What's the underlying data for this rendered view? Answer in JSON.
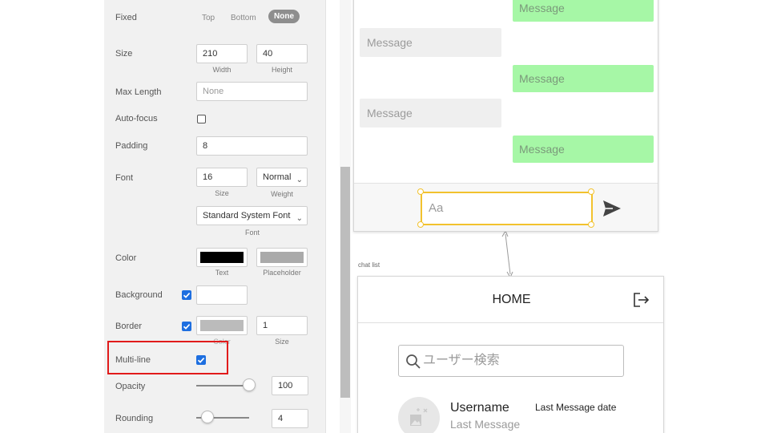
{
  "panel": {
    "fixed": {
      "label": "Fixed",
      "options": [
        "Top",
        "Bottom"
      ],
      "selected": "None"
    },
    "size": {
      "label": "Size",
      "width": "210",
      "height": "40",
      "width_caption": "Width",
      "height_caption": "Height"
    },
    "max_length": {
      "label": "Max Length",
      "placeholder": "None"
    },
    "auto_focus": {
      "label": "Auto-focus",
      "checked": false
    },
    "padding": {
      "label": "Padding",
      "value": "8"
    },
    "font": {
      "label": "Font",
      "size": "16",
      "size_caption": "Size",
      "weight": "Normal",
      "weight_caption": "Weight",
      "family": "Standard System Font",
      "family_caption": "Font"
    },
    "color": {
      "label": "Color",
      "text_caption": "Text",
      "placeholder_caption": "Placeholder",
      "text_color": "#000000",
      "placeholder_color": "#aaaaaa"
    },
    "background": {
      "label": "Background",
      "checked": true,
      "color": "#ffffff"
    },
    "border": {
      "label": "Border",
      "checked": true,
      "color": "#bbbbbb",
      "size": "1",
      "color_caption": "Color",
      "size_caption": "Size"
    },
    "multi_line": {
      "label": "Multi-line",
      "checked": true
    },
    "opacity": {
      "label": "Opacity",
      "value": "100",
      "level": 1.0
    },
    "rounding": {
      "label": "Rounding",
      "value": "4"
    }
  },
  "chat": {
    "messages": [
      {
        "side": "right",
        "text": "Message"
      },
      {
        "side": "left",
        "text": "Message"
      },
      {
        "side": "right",
        "text": "Message"
      },
      {
        "side": "left",
        "text": "Message"
      },
      {
        "side": "right",
        "text": "Message"
      }
    ],
    "input_placeholder": "Aa",
    "send_icon": "send-icon"
  },
  "chat_list": {
    "label": "chat list",
    "title": "HOME",
    "logout_icon": "logout-icon",
    "search_placeholder": "ユーザー検索",
    "item": {
      "username": "Username",
      "last_message": "Last Message",
      "last_date": "Last Message date"
    }
  },
  "colors": {
    "selection": "#f2c22e",
    "highlight": "#e11b1b",
    "sent_bubble": "#a6f7a6",
    "checkbox": "#1e6fe0"
  }
}
